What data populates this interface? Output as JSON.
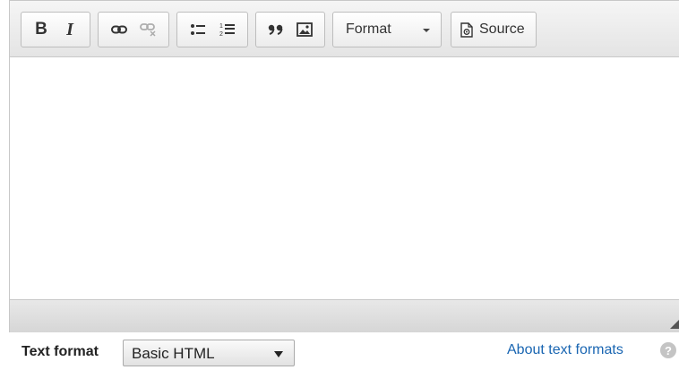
{
  "toolbar": {
    "bold_label": "B",
    "italic_label": "I",
    "format_dropdown": {
      "selected": "Format"
    },
    "source_label": "Source"
  },
  "icons": {
    "link": "link-icon",
    "unlink": "unlink-icon",
    "bulleted_list": "bulleted-list-icon",
    "numbered_list": "numbered-list-icon",
    "blockquote": "blockquote-icon",
    "image": "image-icon",
    "source": "source-icon",
    "resize": "resize-handle-icon",
    "help": "help-icon"
  },
  "text_format": {
    "label": "Text format",
    "selected": "Basic HTML",
    "about_link": "About text formats",
    "help_glyph": "?"
  },
  "colors": {
    "link": "#1a66b2",
    "toolbar_bg": "#e4e4e4",
    "border": "#c8c8c8"
  }
}
